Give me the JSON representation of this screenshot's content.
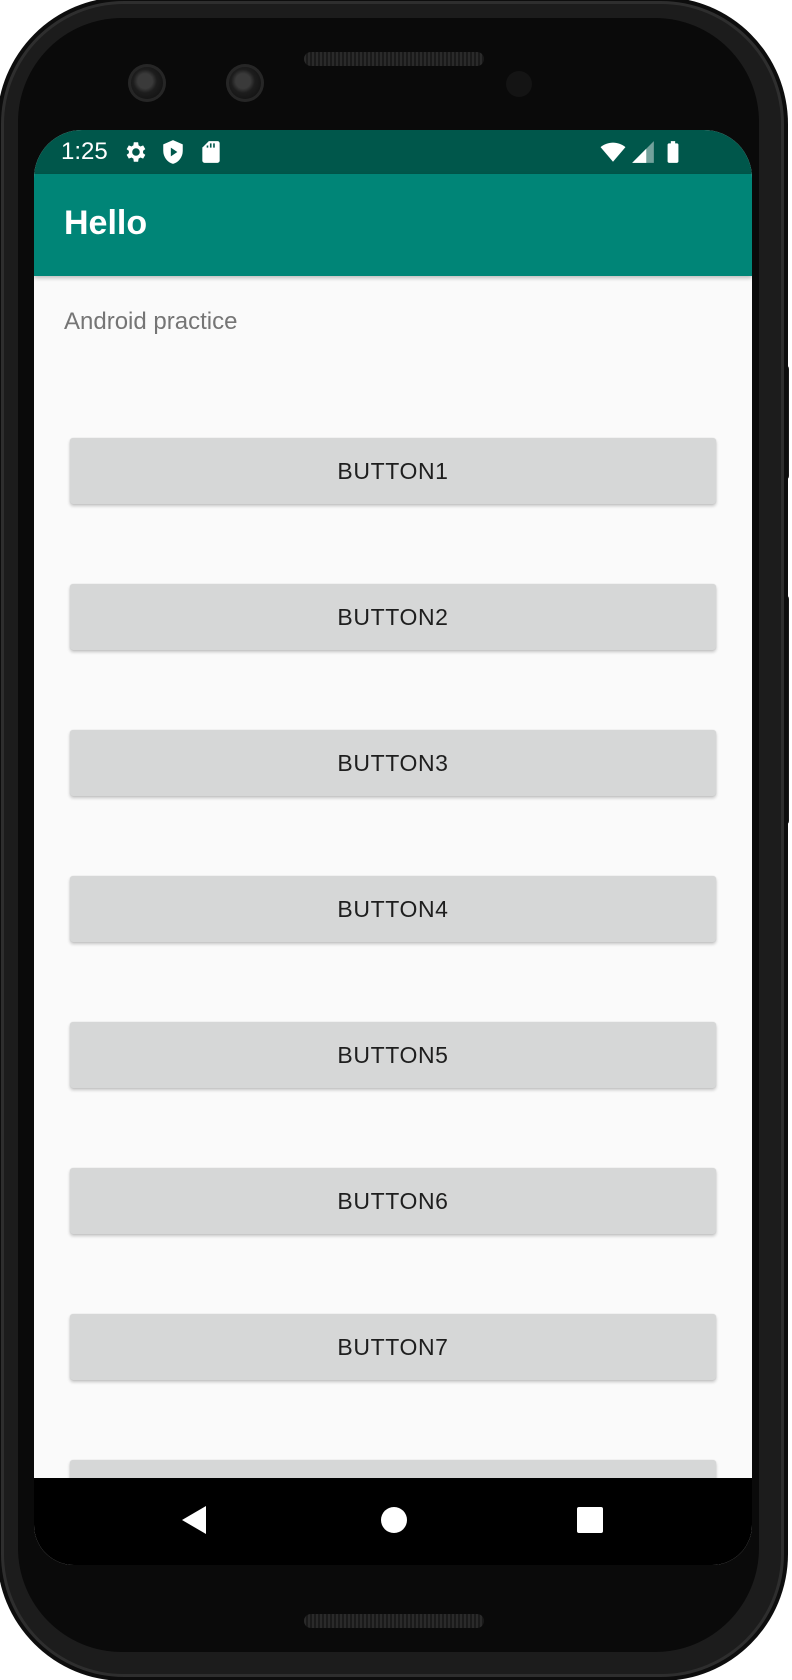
{
  "status_bar": {
    "time": "1:25",
    "icons_left": [
      "gear-icon",
      "shield-play-icon",
      "sd-card-icon"
    ],
    "icons_right": [
      "wifi-icon",
      "signal-icon",
      "battery-icon"
    ],
    "color": "#00574b"
  },
  "app_bar": {
    "title": "Hello",
    "color": "#008577"
  },
  "main": {
    "subtitle": "Android practice",
    "buttons": [
      {
        "label": "BUTTON1"
      },
      {
        "label": "BUTTON2"
      },
      {
        "label": "BUTTON3"
      },
      {
        "label": "BUTTON4"
      },
      {
        "label": "BUTTON5"
      },
      {
        "label": "BUTTON6"
      },
      {
        "label": "BUTTON7"
      },
      {
        "label": ""
      }
    ]
  },
  "nav_bar": {
    "icons": [
      "back-icon",
      "home-icon",
      "recents-icon"
    ]
  }
}
